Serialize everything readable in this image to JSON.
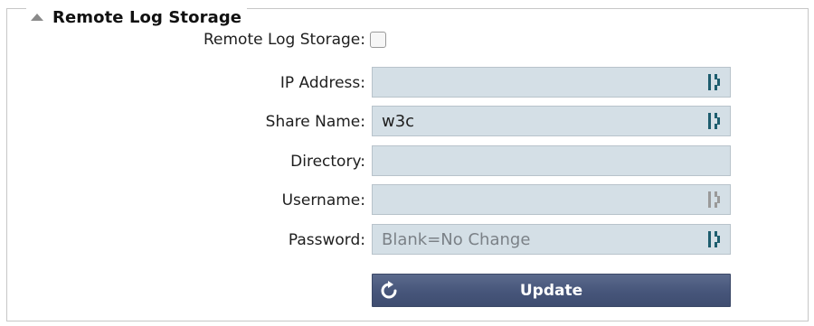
{
  "section": {
    "title": "Remote Log Storage"
  },
  "form": {
    "enable_label": "Remote Log Storage:",
    "enable_checked": false,
    "ip_label": "IP Address:",
    "ip_value": "",
    "share_label": "Share Name:",
    "share_value": "w3c",
    "directory_label": "Directory:",
    "directory_value": "",
    "username_label": "Username:",
    "username_value": "",
    "password_label": "Password:",
    "password_placeholder": "Blank=No Change",
    "update_label": "Update"
  },
  "icons": {
    "collapse": "triangle-up-icon",
    "field_key": "password-manager-key-icon",
    "update": "refresh-icon"
  },
  "colors": {
    "field_bg": "#d4dfe6",
    "key_icon_active": "#1d5d6e",
    "key_icon_muted": "#9a9a9a",
    "button_bg": "#46557a"
  }
}
